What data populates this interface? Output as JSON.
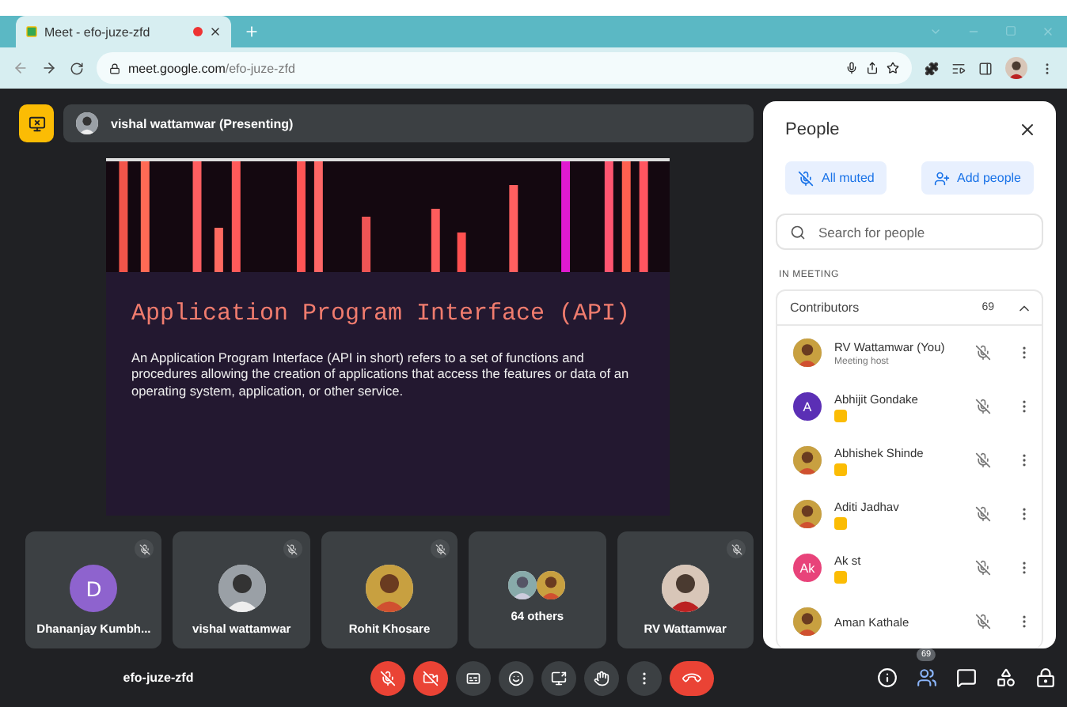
{
  "browser": {
    "tab": {
      "title": "Meet - efo-juze-zfd",
      "recording": true
    },
    "url": {
      "host": "meet.google.com",
      "path": "/efo-juze-zfd"
    }
  },
  "presenting": {
    "label": "vishal wattamwar (Presenting)"
  },
  "slide": {
    "title": "Application Program Interface (API)",
    "body": "An Application Program Interface (API in short) refers to a set of functions and procedures allowing the creation of applications that access the features or data of an operating system, application, or other service."
  },
  "tiles": [
    {
      "kind": "letter",
      "letter": "D",
      "color": "#8e63ce",
      "name": "Dhananjay Kumbh...",
      "muted": true
    },
    {
      "name": "vishal wattamwar",
      "muted": true
    },
    {
      "name": "Rohit Khosare",
      "muted": true
    },
    {
      "kind": "group",
      "name": "64 others",
      "muted": false
    },
    {
      "name": "RV Wattamwar",
      "muted": true
    }
  ],
  "meeting_code": "efo-juze-zfd",
  "controls": [
    {
      "kind": "mic",
      "on": false
    },
    {
      "kind": "camera",
      "on": false
    },
    {
      "kind": "captions",
      "on": false
    },
    {
      "kind": "emoji",
      "on": false
    },
    {
      "kind": "present",
      "on": false
    },
    {
      "kind": "hand",
      "on": false
    },
    {
      "kind": "more",
      "on": false
    },
    {
      "kind": "leave"
    }
  ],
  "side_controls": [
    {
      "kind": "info",
      "selected": false
    },
    {
      "kind": "people",
      "selected": true,
      "count": "69"
    },
    {
      "kind": "chat",
      "selected": false
    },
    {
      "kind": "activities",
      "selected": false
    },
    {
      "kind": "host",
      "selected": false
    }
  ],
  "people_panel": {
    "title": "People",
    "buttons": [
      {
        "kind": "mute",
        "label": "All muted"
      },
      {
        "kind": "add",
        "label": "Add people"
      }
    ],
    "search": {
      "placeholder": "Search for people"
    },
    "section": "IN MEETING",
    "group": {
      "label": "Contributors",
      "count": "69",
      "expanded": true
    },
    "people": [
      {
        "name": "RV Wattamwar (You)",
        "subtitle": "Meeting host",
        "badge": false,
        "muted": true
      },
      {
        "name": "Abhijit Gondake",
        "avatar": {
          "kind": "letter",
          "letter": "A",
          "color": "#5b2fb5"
        },
        "badge": true,
        "muted": true
      },
      {
        "name": "Abhishek Shinde",
        "badge": true,
        "muted": true
      },
      {
        "name": "Aditi Jadhav",
        "badge": true,
        "muted": true
      },
      {
        "name": "Ak st",
        "avatar": {
          "kind": "letter",
          "letter": "Ak",
          "color": "#e8437a"
        },
        "badge": true,
        "muted": true
      },
      {
        "name": "Aman Kathale",
        "badge": false,
        "muted": true
      }
    ]
  }
}
